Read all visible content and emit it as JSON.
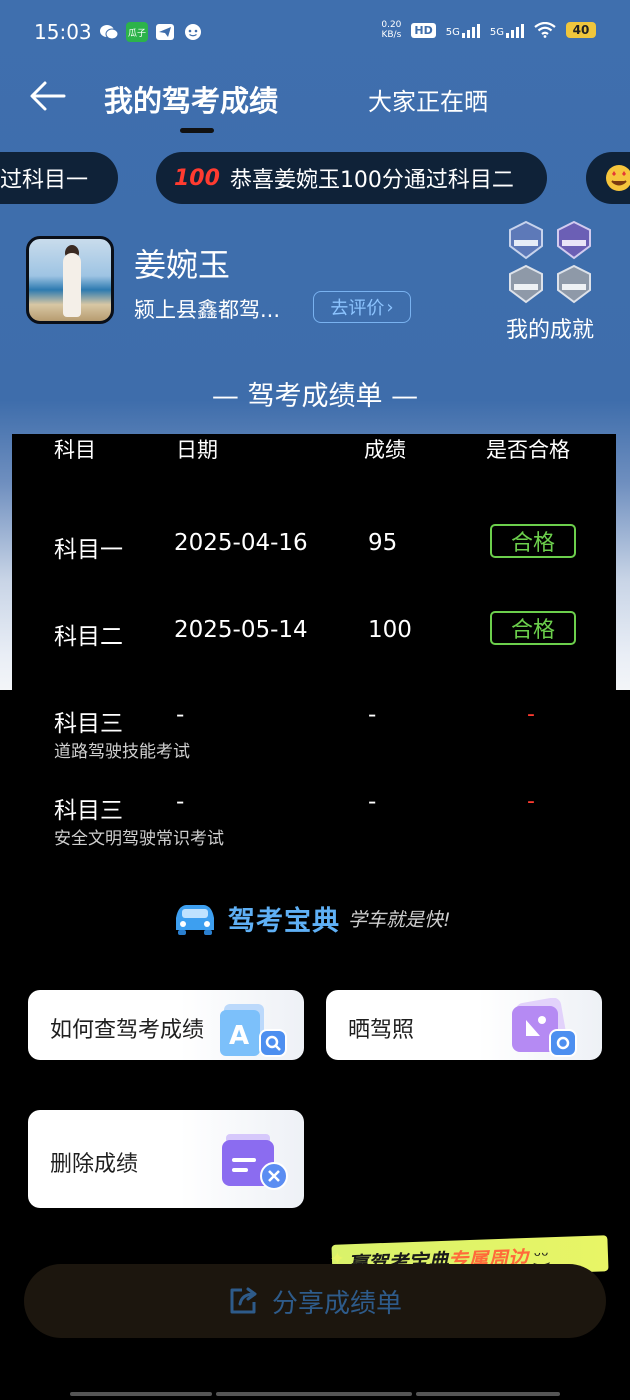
{
  "status_bar": {
    "time": "15:03",
    "net_speed": "0.20",
    "net_unit": "KB/s",
    "hd": "HD",
    "sig1": "5G",
    "sig2": "5G",
    "battery": "40",
    "app_icons": [
      "wechat-icon",
      "gua-zi-icon",
      "telegram-icon",
      "face-icon"
    ]
  },
  "nav": {
    "title": "我的驾考成绩",
    "tab2": "大家正在晒"
  },
  "ticker": {
    "items": [
      "过科目一",
      "恭喜姜婉玉100分通过科目二",
      ""
    ],
    "emoji_text": "100"
  },
  "profile": {
    "name": "姜婉玉",
    "school": "颍上县鑫都驾...",
    "rate_button": "去评价",
    "achievements_label": "我的成就"
  },
  "sheet": {
    "title": "— 驾考成绩单 —",
    "headers": [
      "科目",
      "日期",
      "成绩",
      "是否合格"
    ],
    "rows": [
      {
        "subject": "科目一",
        "subtitle": "",
        "date": "2025-04-16",
        "score": "95",
        "result": "合格"
      },
      {
        "subject": "科目二",
        "subtitle": "",
        "date": "2025-05-14",
        "score": "100",
        "result": "合格"
      },
      {
        "subject": "科目三",
        "subtitle": "道路驾驶技能考试",
        "date": "-",
        "score": "-",
        "result": "-"
      },
      {
        "subject": "科目三",
        "subtitle": "安全文明驾驶常识考试",
        "date": "-",
        "score": "-",
        "result": "-"
      }
    ]
  },
  "brand": {
    "name": "驾考宝典",
    "slogan": "学车就是快!"
  },
  "actions": {
    "check_score": "如何查驾考成绩",
    "show_license": "晒驾照",
    "delete_score": "删除成绩"
  },
  "promo": {
    "part1": "赢驾考宝典",
    "part2": "专属周边"
  },
  "share_button": "分享成绩单",
  "colors": {
    "header_blue": "#3e6dab",
    "pass_green": "#6ccf4c",
    "fail_red": "#ff3b30",
    "link_blue": "#8cc4ff"
  }
}
